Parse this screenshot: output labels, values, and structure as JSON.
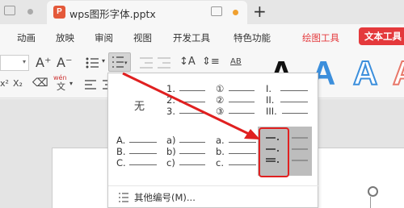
{
  "titlebar": {
    "document_title": "wps图形字体.pptx",
    "new_tab_label": "+",
    "app_logo_text": "P"
  },
  "menu": {
    "items": [
      "动画",
      "放映",
      "审阅",
      "视图",
      "开发工具",
      "特色功能",
      "绘图工具"
    ],
    "active_tab": "文本工具"
  },
  "toolbar": {
    "font_grow": "A⁺",
    "font_shrink": "A⁻",
    "superscript": "x²",
    "subscript": "X₂",
    "phonetic": "wén",
    "text_direction": "AB",
    "style_letters": [
      "A",
      "A",
      "A",
      "A"
    ]
  },
  "numbering_dropdown": {
    "none_label": "无",
    "row1": [
      {
        "markers": [
          "1.",
          "2.",
          "3."
        ]
      },
      {
        "markers": [
          "①",
          "②",
          "③"
        ]
      },
      {
        "markers": [
          "I.",
          "II.",
          "III."
        ]
      }
    ],
    "row2": [
      {
        "markers": [
          "A.",
          "B.",
          "C."
        ]
      },
      {
        "markers": [
          "a)",
          "b)",
          "c)"
        ]
      },
      {
        "markers": [
          "a.",
          "b.",
          "c."
        ]
      }
    ],
    "more_label": "其他编号(M)..."
  },
  "colors": {
    "accent_red": "#e4393c",
    "annotation_red": "#e02020",
    "style_blue": "#3c8fdc",
    "style_pink": "#e8786a"
  }
}
